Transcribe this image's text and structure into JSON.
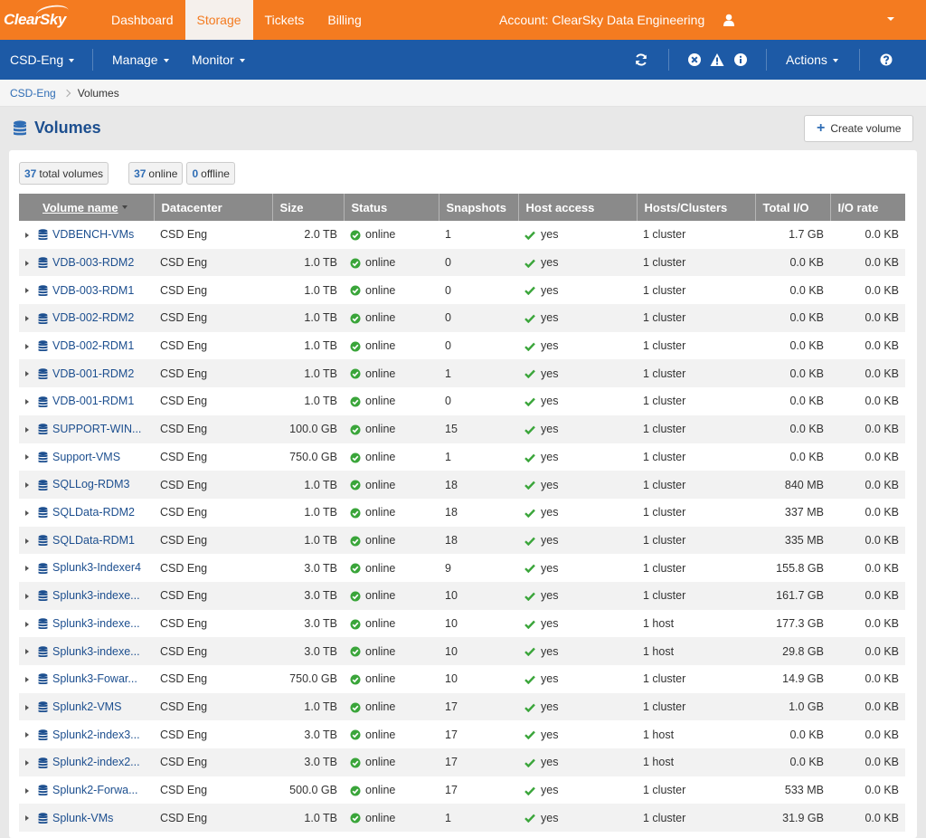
{
  "brand": {
    "logo_text": "ClearSky",
    "primary": "#f47b20",
    "nav_blue": "#1d5aa6",
    "status_green": "#3aa53a"
  },
  "topnav": {
    "tabs": [
      {
        "label": "Dashboard"
      },
      {
        "label": "Storage"
      },
      {
        "label": "Tickets"
      },
      {
        "label": "Billing"
      }
    ],
    "account_label": "Account: ClearSky Data Engineering"
  },
  "subnav": {
    "org": "CSD-Eng",
    "manage": "Manage",
    "monitor": "Monitor",
    "actions": "Actions"
  },
  "breadcrumb": {
    "parent": "CSD-Eng",
    "current": "Volumes"
  },
  "page": {
    "title": "Volumes",
    "create_label": "Create volume"
  },
  "counts": {
    "total_num": "37",
    "total_label": "total volumes",
    "online_num": "37",
    "online_label": "online",
    "offline_num": "0",
    "offline_label": "offline"
  },
  "table": {
    "columns": [
      "Volume name",
      "Datacenter",
      "Size",
      "Status",
      "Snapshots",
      "Host access",
      "Hosts/Clusters",
      "Total I/O",
      "I/O rate"
    ],
    "rows": [
      [
        "VDBENCH-VMs",
        "CSD Eng",
        "2.0 TB",
        "online",
        "1",
        "yes",
        "1 cluster",
        "1.7 GB",
        "0.0 KB"
      ],
      [
        "VDB-003-RDM2",
        "CSD Eng",
        "1.0 TB",
        "online",
        "0",
        "yes",
        "1 cluster",
        "0.0 KB",
        "0.0 KB"
      ],
      [
        "VDB-003-RDM1",
        "CSD Eng",
        "1.0 TB",
        "online",
        "0",
        "yes",
        "1 cluster",
        "0.0 KB",
        "0.0 KB"
      ],
      [
        "VDB-002-RDM2",
        "CSD Eng",
        "1.0 TB",
        "online",
        "0",
        "yes",
        "1 cluster",
        "0.0 KB",
        "0.0 KB"
      ],
      [
        "VDB-002-RDM1",
        "CSD Eng",
        "1.0 TB",
        "online",
        "0",
        "yes",
        "1 cluster",
        "0.0 KB",
        "0.0 KB"
      ],
      [
        "VDB-001-RDM2",
        "CSD Eng",
        "1.0 TB",
        "online",
        "1",
        "yes",
        "1 cluster",
        "0.0 KB",
        "0.0 KB"
      ],
      [
        "VDB-001-RDM1",
        "CSD Eng",
        "1.0 TB",
        "online",
        "0",
        "yes",
        "1 cluster",
        "0.0 KB",
        "0.0 KB"
      ],
      [
        "SUPPORT-WIN...",
        "CSD Eng",
        "100.0 GB",
        "online",
        "15",
        "yes",
        "1 cluster",
        "0.0 KB",
        "0.0 KB"
      ],
      [
        "Support-VMS",
        "CSD Eng",
        "750.0 GB",
        "online",
        "1",
        "yes",
        "1 cluster",
        "0.0 KB",
        "0.0 KB"
      ],
      [
        "SQLLog-RDM3",
        "CSD Eng",
        "1.0 TB",
        "online",
        "18",
        "yes",
        "1 cluster",
        "840 MB",
        "0.0 KB"
      ],
      [
        "SQLData-RDM2",
        "CSD Eng",
        "1.0 TB",
        "online",
        "18",
        "yes",
        "1 cluster",
        "337 MB",
        "0.0 KB"
      ],
      [
        "SQLData-RDM1",
        "CSD Eng",
        "1.0 TB",
        "online",
        "18",
        "yes",
        "1 cluster",
        "335 MB",
        "0.0 KB"
      ],
      [
        "Splunk3-Indexer4",
        "CSD Eng",
        "3.0 TB",
        "online",
        "9",
        "yes",
        "1 cluster",
        "155.8 GB",
        "0.0 KB"
      ],
      [
        "Splunk3-indexe...",
        "CSD Eng",
        "3.0 TB",
        "online",
        "10",
        "yes",
        "1 cluster",
        "161.7 GB",
        "0.0 KB"
      ],
      [
        "Splunk3-indexe...",
        "CSD Eng",
        "3.0 TB",
        "online",
        "10",
        "yes",
        "1 host",
        "177.3 GB",
        "0.0 KB"
      ],
      [
        "Splunk3-indexe...",
        "CSD Eng",
        "3.0 TB",
        "online",
        "10",
        "yes",
        "1 host",
        "29.8 GB",
        "0.0 KB"
      ],
      [
        "Splunk3-Fowar...",
        "CSD Eng",
        "750.0 GB",
        "online",
        "10",
        "yes",
        "1 cluster",
        "14.9 GB",
        "0.0 KB"
      ],
      [
        "Splunk2-VMS",
        "CSD Eng",
        "1.0 TB",
        "online",
        "17",
        "yes",
        "1 cluster",
        "1.0 GB",
        "0.0 KB"
      ],
      [
        "Splunk2-index3...",
        "CSD Eng",
        "3.0 TB",
        "online",
        "17",
        "yes",
        "1 host",
        "0.0 KB",
        "0.0 KB"
      ],
      [
        "Splunk2-index2...",
        "CSD Eng",
        "3.0 TB",
        "online",
        "17",
        "yes",
        "1 host",
        "0.0 KB",
        "0.0 KB"
      ],
      [
        "Splunk2-Forwa...",
        "CSD Eng",
        "500.0 GB",
        "online",
        "17",
        "yes",
        "1 cluster",
        "533 MB",
        "0.0 KB"
      ],
      [
        "Splunk-VMs",
        "CSD Eng",
        "1.0 TB",
        "online",
        "1",
        "yes",
        "1 cluster",
        "31.9 GB",
        "0.0 KB"
      ]
    ]
  }
}
